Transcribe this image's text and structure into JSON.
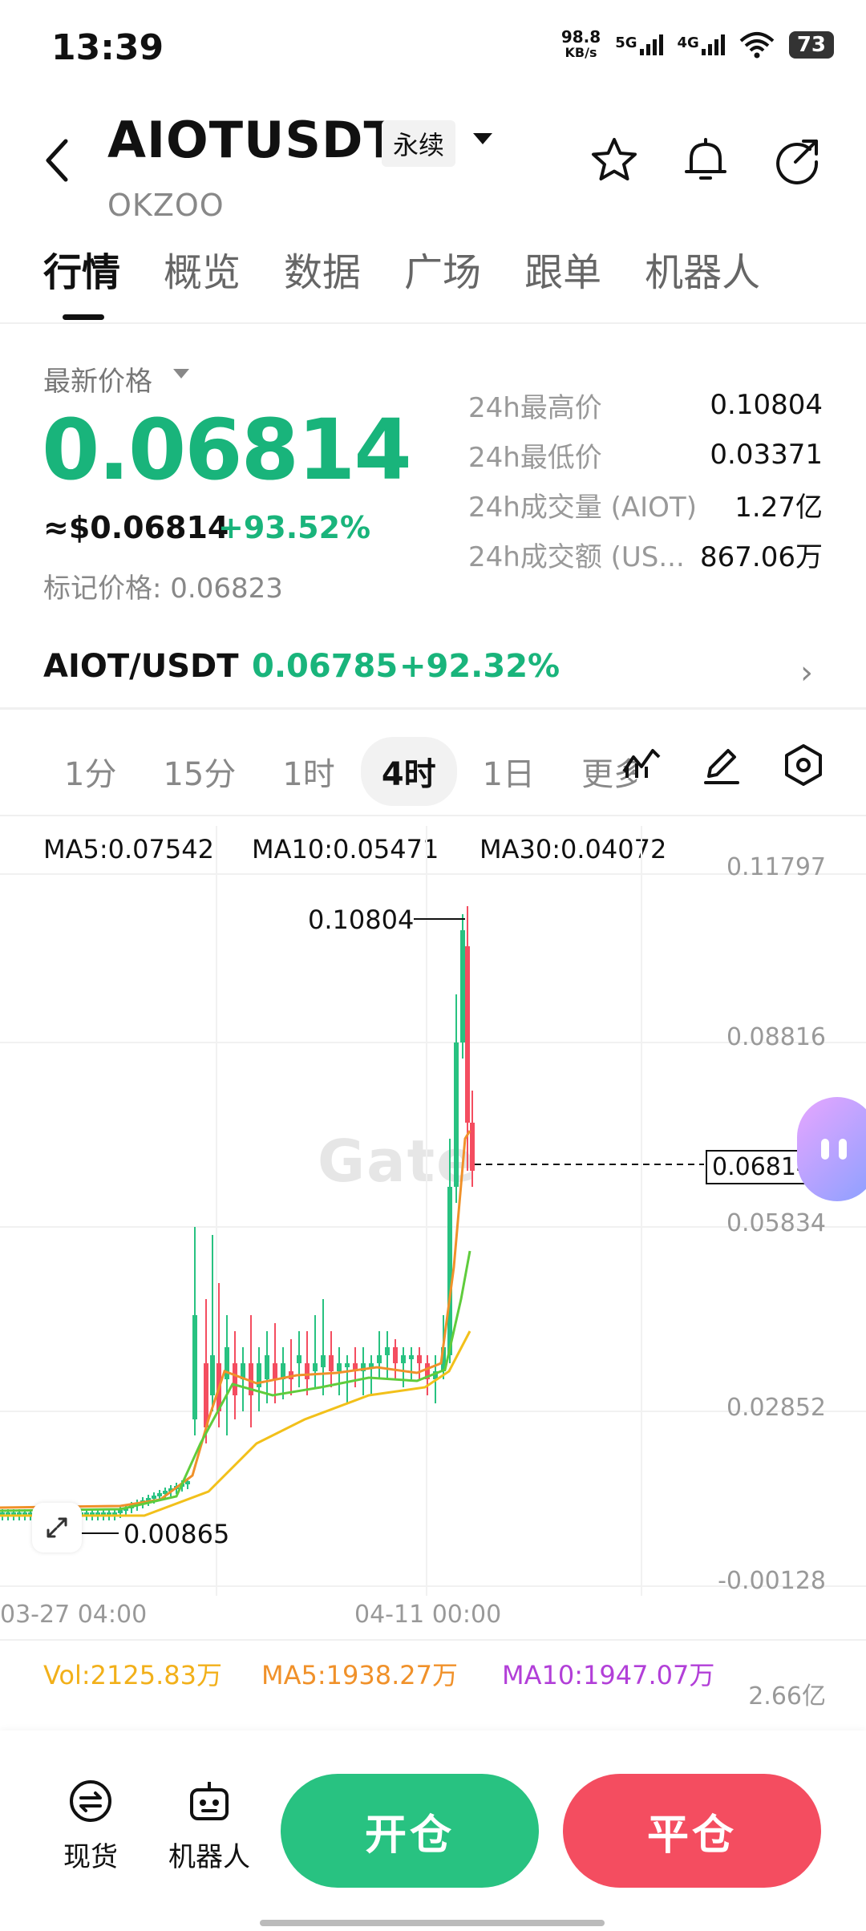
{
  "status_bar": {
    "time": "13:39",
    "net_speed_value": "98.8",
    "net_speed_unit": "KB/s",
    "sig1": "5G",
    "sig2": "4G",
    "battery": "73"
  },
  "header": {
    "symbol": "AIOTUSDT",
    "contract_type": "永续",
    "subtitle": "OKZOO"
  },
  "tabs": [
    "行情",
    "概览",
    "数据",
    "广场",
    "跟单",
    "机器人"
  ],
  "price": {
    "latest_label": "最新价格",
    "last": "0.06814",
    "usd": "≈$0.06814",
    "change": "+93.52%",
    "mark": "标记价格: 0.06823"
  },
  "stats": [
    {
      "k": "24h最高价",
      "v": "0.10804"
    },
    {
      "k": "24h最低价",
      "v": "0.03371"
    },
    {
      "k": "24h成交量 (AIOT)",
      "v": "1.27亿"
    },
    {
      "k": "24h成交额 (US...",
      "v": "867.06万"
    }
  ],
  "spot": {
    "pair": "AIOT/USDT",
    "price": "0.06785",
    "change": "+92.32%"
  },
  "intervals": [
    "1分",
    "15分",
    "1时",
    "4时",
    "1日",
    "更多"
  ],
  "chart": {
    "ma5": "MA5:0.07542",
    "ma10": "MA10:0.05471",
    "ma30": "MA30:0.04072",
    "yticks": [
      "0.11797",
      "0.08816",
      "0.05834",
      "0.02852",
      "-0.00128"
    ],
    "high_label": "0.10804",
    "low_label": "0.00865",
    "last_tag": "0.06814",
    "x_start": "03-27 04:00",
    "x_mid": "04-11 00:00",
    "watermark": "Gate",
    "colors": {
      "ma5": "#f0912a",
      "ma10": "#5fcc3c",
      "ma30": "#f2c01a",
      "up": "#28c281",
      "down": "#f44d60"
    }
  },
  "volume": {
    "vol": "Vol:2125.83万",
    "ma5": "MA5:1938.27万",
    "ma10": "MA10:1947.07万",
    "ymax": "2.66亿"
  },
  "bottom": {
    "spot": "现货",
    "bot": "机器人",
    "open": "开仓",
    "close": "平仓"
  }
}
